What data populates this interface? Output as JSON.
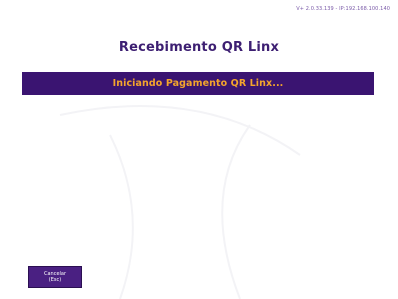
{
  "header": {
    "version": "V+ 2.0.33.139 - IP:192.168.100.140",
    "title": "Recebimento QR Linx"
  },
  "status": {
    "message": "Iniciando Pagamento QR Linx..."
  },
  "actions": {
    "cancel_line1": "Cancelar",
    "cancel_line2": "(Esc)"
  },
  "colors": {
    "accent": "#3a1471",
    "status_text": "#f4a52c",
    "title": "#3d1f72",
    "background": "#ffffff"
  }
}
